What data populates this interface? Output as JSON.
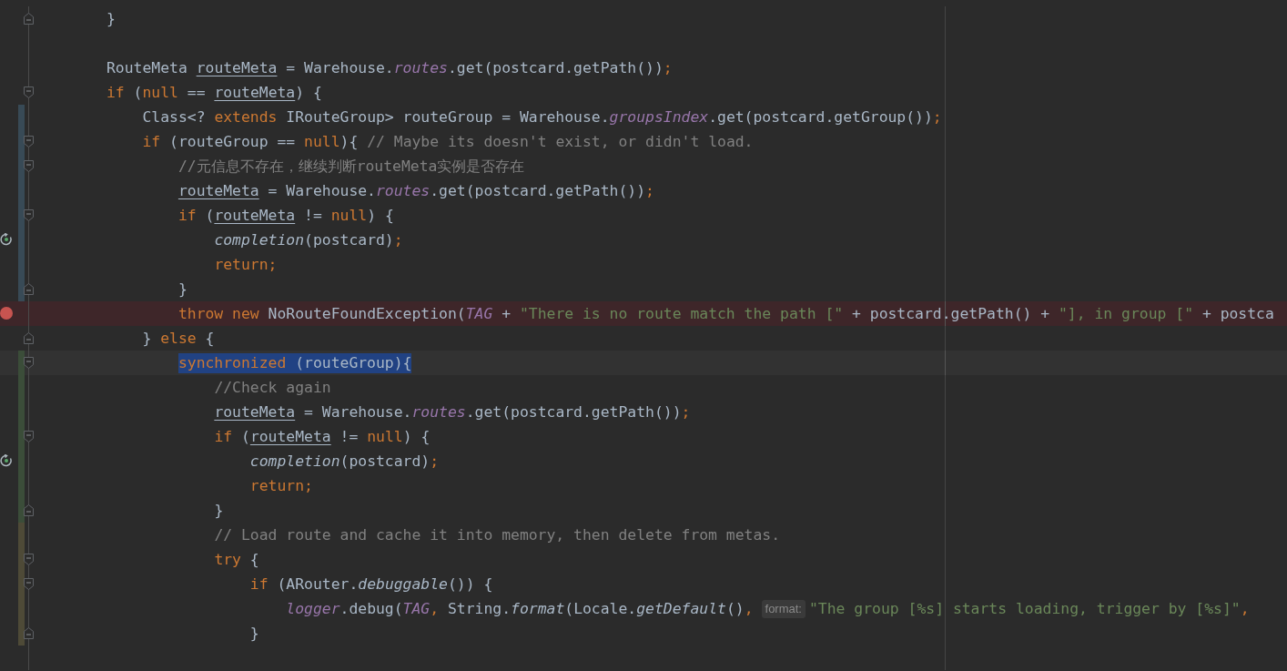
{
  "editor": {
    "lines": [
      {
        "fold_start": false,
        "fold_end": true,
        "breakpoint": false,
        "recursion": false,
        "caret": false,
        "tokens": [
          {
            "kind": "text",
            "text": "        }"
          }
        ]
      },
      {
        "fold_start": false,
        "fold_end": false,
        "breakpoint": false,
        "recursion": false,
        "caret": false
      },
      {
        "fold_start": false,
        "fold_end": false,
        "breakpoint": false,
        "recursion": false,
        "caret": false,
        "tokens": [
          {
            "kind": "text",
            "text": "        RouteMeta "
          },
          {
            "kind": "var",
            "text": "routeMeta"
          },
          {
            "kind": "text",
            "text": " = Warehouse."
          },
          {
            "kind": "field",
            "text": "routes"
          },
          {
            "kind": "text",
            "text": ".get(postcard.getPath())"
          },
          {
            "kind": "punct",
            "text": ";"
          }
        ]
      },
      {
        "fold_start": true,
        "fold_end": false,
        "breakpoint": false,
        "recursion": false,
        "caret": false,
        "tokens": [
          {
            "kind": "keyword",
            "text": "        if"
          },
          {
            "kind": "text",
            "text": " ("
          },
          {
            "kind": "keyword",
            "text": "null"
          },
          {
            "kind": "text",
            "text": " == "
          },
          {
            "kind": "var",
            "text": "routeMeta"
          },
          {
            "kind": "text",
            "text": ") {"
          }
        ]
      },
      {
        "fold_start": false,
        "fold_end": false,
        "breakpoint": false,
        "recursion": false,
        "caret": false,
        "color": "#384a56",
        "tokens": [
          {
            "kind": "text",
            "text": "            Class<? "
          },
          {
            "kind": "keyword",
            "text": "extends"
          },
          {
            "kind": "text",
            "text": " IRouteGroup> routeGroup = Warehouse."
          },
          {
            "kind": "field",
            "text": "groupsIndex"
          },
          {
            "kind": "text",
            "text": ".get(postcard.getGroup())"
          },
          {
            "kind": "punct",
            "text": ";"
          }
        ]
      },
      {
        "fold_start": true,
        "fold_end": false,
        "breakpoint": false,
        "recursion": false,
        "caret": false,
        "color": "#384a56",
        "tokens": [
          {
            "kind": "keyword",
            "text": "            if"
          },
          {
            "kind": "text",
            "text": " (routeGroup == "
          },
          {
            "kind": "keyword",
            "text": "null"
          },
          {
            "kind": "text",
            "text": "){ "
          },
          {
            "kind": "comment",
            "text": "// Maybe its doesn't exist, or didn't load."
          }
        ]
      },
      {
        "fold_start": true,
        "fold_end": false,
        "breakpoint": false,
        "recursion": false,
        "caret": false,
        "color": "#384a56",
        "tokens": [
          {
            "kind": "comment",
            "text": "                //元信息不存在，继续判断routeMeta实例是否存在"
          }
        ]
      },
      {
        "fold_start": false,
        "fold_end": false,
        "breakpoint": false,
        "recursion": false,
        "caret": false,
        "color": "#384a56",
        "tokens": [
          {
            "kind": "var",
            "text": "                routeMeta"
          },
          {
            "kind": "text",
            "text": " = Warehouse."
          },
          {
            "kind": "field",
            "text": "routes"
          },
          {
            "kind": "text",
            "text": ".get(postcard.getPath())"
          },
          {
            "kind": "punct",
            "text": ";"
          }
        ]
      },
      {
        "fold_start": true,
        "fold_end": false,
        "breakpoint": false,
        "recursion": false,
        "caret": false,
        "color": "#384a56",
        "tokens": [
          {
            "kind": "keyword",
            "text": "                if"
          },
          {
            "kind": "text",
            "text": " ("
          },
          {
            "kind": "var",
            "text": "routeMeta"
          },
          {
            "kind": "text",
            "text": " != "
          },
          {
            "kind": "keyword",
            "text": "null"
          },
          {
            "kind": "text",
            "text": ") {"
          }
        ]
      },
      {
        "fold_start": false,
        "fold_end": false,
        "breakpoint": false,
        "recursion": true,
        "caret": false,
        "color": "#384a56",
        "tokens": [
          {
            "kind": "static",
            "text": "                    completion"
          },
          {
            "kind": "text",
            "text": "(postcard)"
          },
          {
            "kind": "punct",
            "text": ";"
          }
        ]
      },
      {
        "fold_start": false,
        "fold_end": false,
        "breakpoint": false,
        "recursion": false,
        "caret": false,
        "color": "#384a56",
        "tokens": [
          {
            "kind": "keyword",
            "text": "                    return;"
          }
        ]
      },
      {
        "fold_start": false,
        "fold_end": true,
        "breakpoint": false,
        "recursion": false,
        "caret": false,
        "color": "#384a56",
        "tokens": [
          {
            "kind": "text",
            "text": "                }"
          }
        ]
      },
      {
        "fold_start": false,
        "fold_end": false,
        "breakpoint": true,
        "recursion": false,
        "caret": false,
        "tokens": [
          {
            "kind": "keyword",
            "text": "                throw new "
          },
          {
            "kind": "text",
            "text": "NoRouteFoundException("
          },
          {
            "kind": "field",
            "text": "TAG"
          },
          {
            "kind": "text",
            "text": " + "
          },
          {
            "kind": "string",
            "text": "\"There is no route match the path [\""
          },
          {
            "kind": "text",
            "text": " + postcard.getPath() + "
          },
          {
            "kind": "string",
            "text": "\"], in group [\""
          },
          {
            "kind": "text",
            "text": " + postca"
          }
        ]
      },
      {
        "fold_start": false,
        "fold_end": true,
        "breakpoint": false,
        "recursion": false,
        "caret": false,
        "tokens": [
          {
            "kind": "text",
            "text": "            } "
          },
          {
            "kind": "keyword",
            "text": "else"
          },
          {
            "kind": "text",
            "text": " {"
          }
        ]
      },
      {
        "fold_start": true,
        "fold_end": false,
        "breakpoint": false,
        "recursion": false,
        "caret": true,
        "color": "#3b4d39",
        "selected_tokens": [
          {
            "kind": "keyword",
            "text": "                synchronized"
          },
          {
            "kind": "text",
            "text": " (routeGroup){"
          }
        ]
      },
      {
        "fold_start": false,
        "fold_end": false,
        "breakpoint": false,
        "recursion": false,
        "caret": false,
        "color": "#3b4d39",
        "tokens": [
          {
            "kind": "comment",
            "text": "                    //Check again"
          }
        ]
      },
      {
        "fold_start": false,
        "fold_end": false,
        "breakpoint": false,
        "recursion": false,
        "caret": false,
        "color": "#3b4d39",
        "tokens": [
          {
            "kind": "var",
            "text": "                    routeMeta"
          },
          {
            "kind": "text",
            "text": " = Warehouse."
          },
          {
            "kind": "field",
            "text": "routes"
          },
          {
            "kind": "text",
            "text": ".get(postcard.getPath())"
          },
          {
            "kind": "punct",
            "text": ";"
          }
        ]
      },
      {
        "fold_start": true,
        "fold_end": false,
        "breakpoint": false,
        "recursion": false,
        "caret": false,
        "color": "#3b4d39",
        "tokens": [
          {
            "kind": "keyword",
            "text": "                    if"
          },
          {
            "kind": "text",
            "text": " ("
          },
          {
            "kind": "var",
            "text": "routeMeta"
          },
          {
            "kind": "text",
            "text": " != "
          },
          {
            "kind": "keyword",
            "text": "null"
          },
          {
            "kind": "text",
            "text": ") {"
          }
        ]
      },
      {
        "fold_start": false,
        "fold_end": false,
        "breakpoint": false,
        "recursion": true,
        "caret": false,
        "color": "#3b4d39",
        "tokens": [
          {
            "kind": "static",
            "text": "                        completion"
          },
          {
            "kind": "text",
            "text": "(postcard)"
          },
          {
            "kind": "punct",
            "text": ";"
          }
        ]
      },
      {
        "fold_start": false,
        "fold_end": false,
        "breakpoint": false,
        "recursion": false,
        "caret": false,
        "color": "#3b4d39",
        "tokens": [
          {
            "kind": "keyword",
            "text": "                        return;"
          }
        ]
      },
      {
        "fold_start": false,
        "fold_end": true,
        "breakpoint": false,
        "recursion": false,
        "caret": false,
        "color": "#3b4d39",
        "tokens": [
          {
            "kind": "text",
            "text": "                    }"
          }
        ]
      },
      {
        "fold_start": false,
        "fold_end": false,
        "breakpoint": false,
        "recursion": false,
        "caret": false,
        "color": "#4e4a37",
        "tokens": [
          {
            "kind": "comment",
            "text": "                    // Load route and cache it into memory, then delete from metas."
          }
        ]
      },
      {
        "fold_start": true,
        "fold_end": false,
        "breakpoint": false,
        "recursion": false,
        "caret": false,
        "color": "#4e4a37",
        "tokens": [
          {
            "kind": "keyword",
            "text": "                    try"
          },
          {
            "kind": "text",
            "text": " {"
          }
        ]
      },
      {
        "fold_start": true,
        "fold_end": false,
        "breakpoint": false,
        "recursion": false,
        "caret": false,
        "color": "#4e4a37",
        "tokens": [
          {
            "kind": "keyword",
            "text": "                        if"
          },
          {
            "kind": "text",
            "text": " (ARouter."
          },
          {
            "kind": "static",
            "text": "debuggable"
          },
          {
            "kind": "text",
            "text": "()) {"
          }
        ]
      },
      {
        "fold_start": false,
        "fold_end": false,
        "breakpoint": false,
        "recursion": false,
        "caret": false,
        "color": "#4e4a37",
        "tokens": [
          {
            "kind": "field",
            "text": "                            logger"
          },
          {
            "kind": "text",
            "text": ".debug("
          },
          {
            "kind": "field",
            "text": "TAG"
          },
          {
            "kind": "punct",
            "text": ","
          },
          {
            "kind": "text",
            "text": " String."
          },
          {
            "kind": "static",
            "text": "format"
          },
          {
            "kind": "text",
            "text": "(Locale."
          },
          {
            "kind": "static",
            "text": "getDefault"
          },
          {
            "kind": "text",
            "text": "()"
          },
          {
            "kind": "punct",
            "text": ","
          },
          {
            "kind": "hint",
            "text": "format:"
          },
          {
            "kind": "string",
            "text": "\"The group [%s] starts loading, trigger by [%s]\""
          },
          {
            "kind": "punct",
            "text": ","
          }
        ]
      },
      {
        "fold_start": false,
        "fold_end": true,
        "breakpoint": false,
        "recursion": false,
        "caret": false,
        "color": "#4e4a37",
        "tokens": [
          {
            "kind": "text",
            "text": "                        }"
          }
        ]
      },
      {
        "fold_start": false,
        "fold_end": false,
        "breakpoint": false,
        "recursion": false,
        "caret": false
      }
    ]
  }
}
